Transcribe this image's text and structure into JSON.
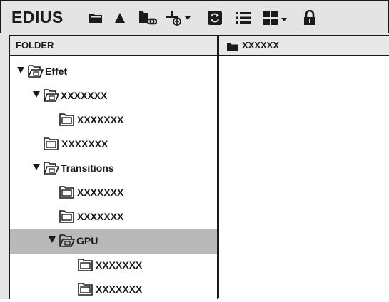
{
  "app": {
    "title": "EDIUS"
  },
  "toolbar": {
    "icons": [
      "folder-icon",
      "up-arrow-icon",
      "folder-link-icon",
      "add-dropdown-icon",
      "refresh-icon",
      "list-view-icon",
      "grid-view-dropdown-icon",
      "lock-icon"
    ]
  },
  "left_panel": {
    "header": "FOLDER"
  },
  "right_panel": {
    "header": "XXXXXX"
  },
  "tree": {
    "items": [
      {
        "label": "Effet",
        "expanded": true,
        "depth": 0
      },
      {
        "label": "XXXXXXX",
        "expanded": true,
        "depth": 1
      },
      {
        "label": "XXXXXXX",
        "expanded": false,
        "depth": 2
      },
      {
        "label": "XXXXXXX",
        "expanded": false,
        "depth": 1
      },
      {
        "label": "Transitions",
        "expanded": true,
        "depth": 1
      },
      {
        "label": "XXXXXXX",
        "expanded": false,
        "depth": 2
      },
      {
        "label": "XXXXXXX",
        "expanded": false,
        "depth": 2
      },
      {
        "label": "GPU",
        "expanded": true,
        "depth": 2,
        "selected": true
      },
      {
        "label": "XXXXXXX",
        "expanded": false,
        "depth": 3
      },
      {
        "label": "XXXXXXX",
        "expanded": false,
        "depth": 3
      }
    ]
  },
  "colors": {
    "selected_row": "#b9b9b9",
    "toolbar_bg": "#e4e4e4",
    "ink": "#1a1a1a"
  }
}
